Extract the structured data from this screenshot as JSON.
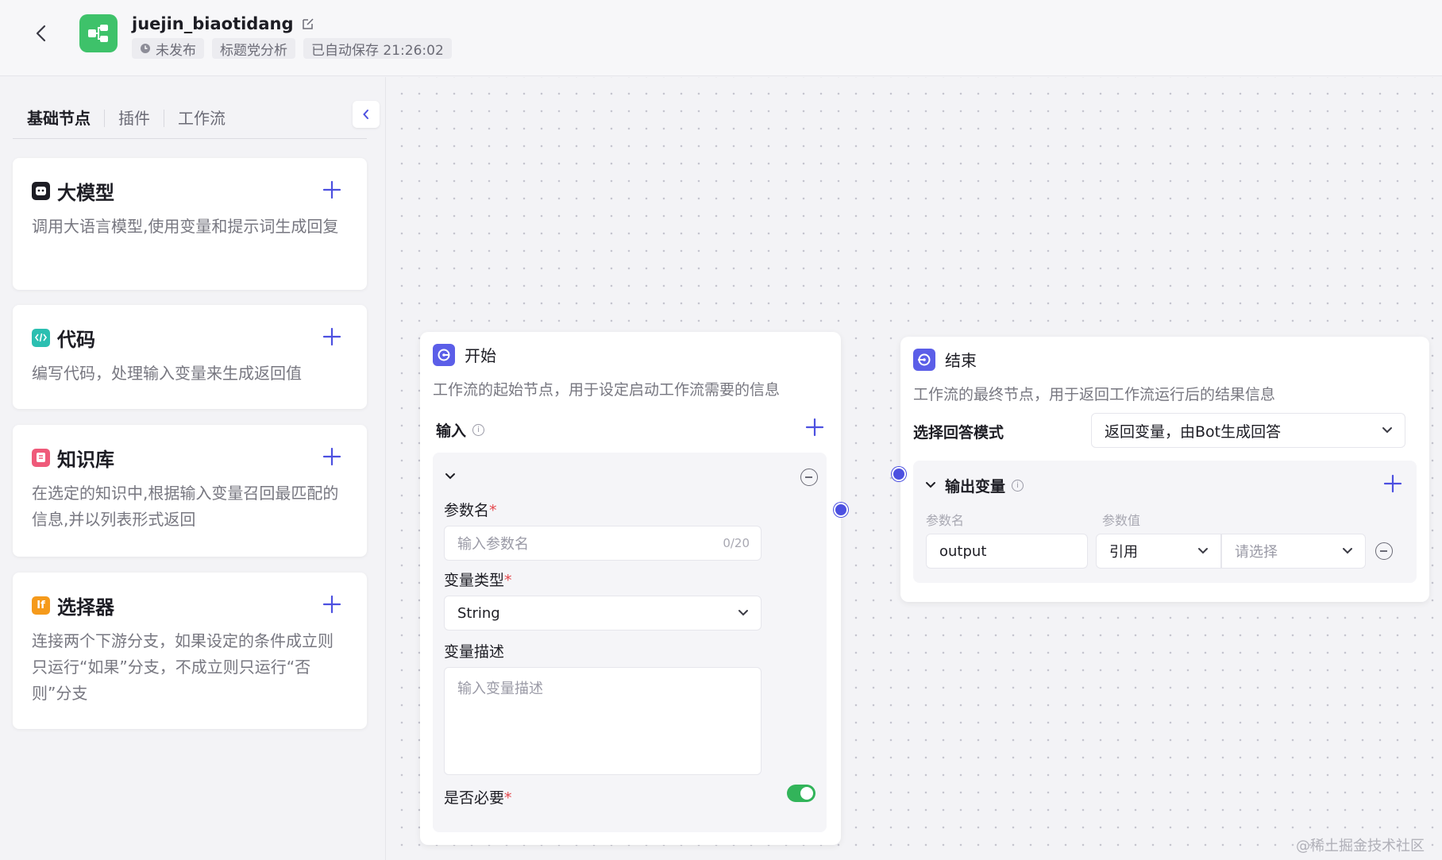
{
  "header": {
    "title": "juejin_biaotidang",
    "status": "未发布",
    "tag": "标题党分析",
    "autosave": "已自动保存 21:26:02"
  },
  "sidebar": {
    "tabs": [
      {
        "label": "基础节点",
        "active": true
      },
      {
        "label": "插件",
        "active": false
      },
      {
        "label": "工作流",
        "active": false
      }
    ],
    "nodes": [
      {
        "title": "大模型",
        "desc": "调用大语言模型,使用变量和提示词生成回复",
        "icon": "llm-icon",
        "color": "#1d1d24"
      },
      {
        "title": "代码",
        "desc": "编写代码，处理输入变量来生成返回值",
        "icon": "code-icon",
        "color": "#2bbfb1"
      },
      {
        "title": "知识库",
        "desc": "在选定的知识中,根据输入变量召回最匹配的信息,并以列表形式返回",
        "icon": "knowledge-icon",
        "color": "#ef5a7a"
      },
      {
        "title": "选择器",
        "desc": "连接两个下游分支，如果设定的条件成立则只运行“如果”分支，不成立则只运行“否则”分支",
        "icon": "selector-icon",
        "color": "#f59a1b",
        "icon_text": "If"
      }
    ]
  },
  "start_node": {
    "title": "开始",
    "desc": "工作流的起始节点，用于设定启动工作流需要的信息",
    "input_label": "输入",
    "param_name_label": "参数名",
    "param_name_placeholder": "输入参数名",
    "param_name_counter": "0/20",
    "var_type_label": "变量类型",
    "var_type_value": "String",
    "var_desc_label": "变量描述",
    "var_desc_placeholder": "输入变量描述",
    "required_label": "是否必要",
    "required_on": true
  },
  "end_node": {
    "title": "结束",
    "desc": "工作流的最终节点，用于返回工作流运行后的结果信息",
    "mode_label": "选择回答模式",
    "mode_value": "返回变量，由Bot生成回答",
    "output_label": "输出变量",
    "col_name": "参数名",
    "col_value": "参数值",
    "param_name": "output",
    "ref_value": "引用",
    "select_placeholder": "请选择"
  },
  "watermark": "@稀土掘金技术社区"
}
